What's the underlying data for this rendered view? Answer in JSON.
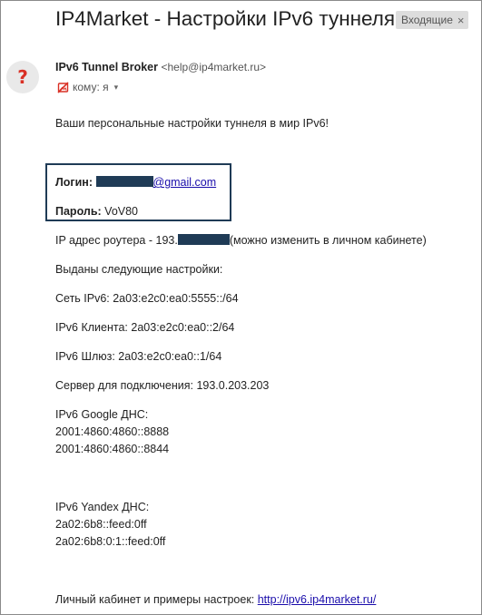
{
  "email": {
    "subject": "IP4Market - Настройки IPv6 туннеля",
    "label": "Входящие",
    "label_close": "×",
    "avatar_glyph": "?",
    "sender_name": "IPv6 Tunnel Broker",
    "sender_email": "<help@ip4market.ru>",
    "recipient": "кому: я",
    "recipient_caret": "▾",
    "intro": "Ваши персональные настройки туннеля в мир IPv6!",
    "login_label": "Логин:",
    "login_domain": "@gmail.com",
    "password_label": "Пароль:",
    "password_value": "VoV80",
    "router_prefix": "IP адрес роутера - 193.",
    "router_suffix": "(можно изменить в личном кабинете)",
    "issued": "Выданы следующие настройки:",
    "ipv6_net": "Сеть IPv6: 2a03:e2c0:ea0:5555::/64",
    "ipv6_client": "IPv6 Клиента: 2a03:e2c0:ea0::2/64",
    "ipv6_gateway": "IPv6 Шлюз: 2a03:e2c0:ea0::1/64",
    "server": "Сервер для подключения: 193.0.203.203",
    "google_dns_title": "IPv6 Google ДНС:",
    "google_dns_1": "2001:4860:4860::8888",
    "google_dns_2": "2001:4860:4860::8844",
    "yandex_dns_title": "IPv6 Yandex ДНС:",
    "yandex_dns_1": "2a02:6b8::feed:0ff",
    "yandex_dns_2": "2a02:6b8:0:1::feed:0ff",
    "cabinet_text": "Личный кабинет и примеры настроек: ",
    "cabinet_link": "http://ipv6.ip4market.ru/"
  },
  "colors": {
    "redaction": "#1f3b56",
    "link": "#1a0dab",
    "avatar_mark": "#d93025"
  },
  "icons": {
    "avatar": "question-mark-icon",
    "recipient": "no-image-icon",
    "close": "close-icon",
    "caret": "chevron-down-icon"
  }
}
